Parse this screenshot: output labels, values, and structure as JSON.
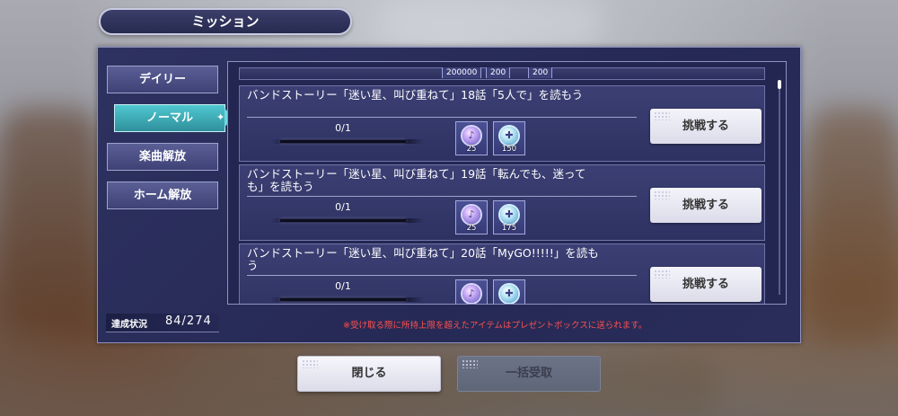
{
  "header": {
    "title": "ミッション"
  },
  "tabs": [
    {
      "label": "デイリー",
      "active": false
    },
    {
      "label": "ノーマル",
      "active": true
    },
    {
      "label": "楽曲解放",
      "active": false
    },
    {
      "label": "ホーム解放",
      "active": false
    }
  ],
  "top_rewards": [
    "200000",
    "200",
    "200"
  ],
  "missions": [
    {
      "title": "バンドストーリー「迷い星、叫び重ねて」18話「5人で」を読もう",
      "progress": "0/1",
      "progress_fraction": 0,
      "rewards": [
        {
          "icon": "star-gem-icon",
          "count": "25"
        },
        {
          "icon": "blue-gem-icon",
          "count": "150"
        }
      ],
      "button": "挑戦する"
    },
    {
      "title": "バンドストーリー「迷い星、叫び重ねて」19話「転んでも、迷っても」を読もう",
      "progress": "0/1",
      "progress_fraction": 0,
      "rewards": [
        {
          "icon": "star-gem-icon",
          "count": "25"
        },
        {
          "icon": "blue-gem-icon",
          "count": "175"
        }
      ],
      "button": "挑戦する"
    },
    {
      "title": "バンドストーリー「迷い星、叫び重ねて」20話「MyGO!!!!!」を読もう",
      "progress": "0/1",
      "progress_fraction": 0,
      "rewards": [
        {
          "icon": "star-gem-icon",
          "count": ""
        },
        {
          "icon": "blue-gem-icon",
          "count": ""
        }
      ],
      "button": "挑戦する"
    }
  ],
  "status": {
    "label": "達成状況",
    "value": "84/274"
  },
  "notice": "※受け取る際に所持上限を超えたアイテムはプレゼントボックスに送られます。",
  "buttons": {
    "close": "閉じる",
    "bulk_receive": "一括受取"
  },
  "colors": {
    "panel": "#2a2d5a",
    "active_tab": "#4fc8d0",
    "notice": "#ff5050"
  }
}
